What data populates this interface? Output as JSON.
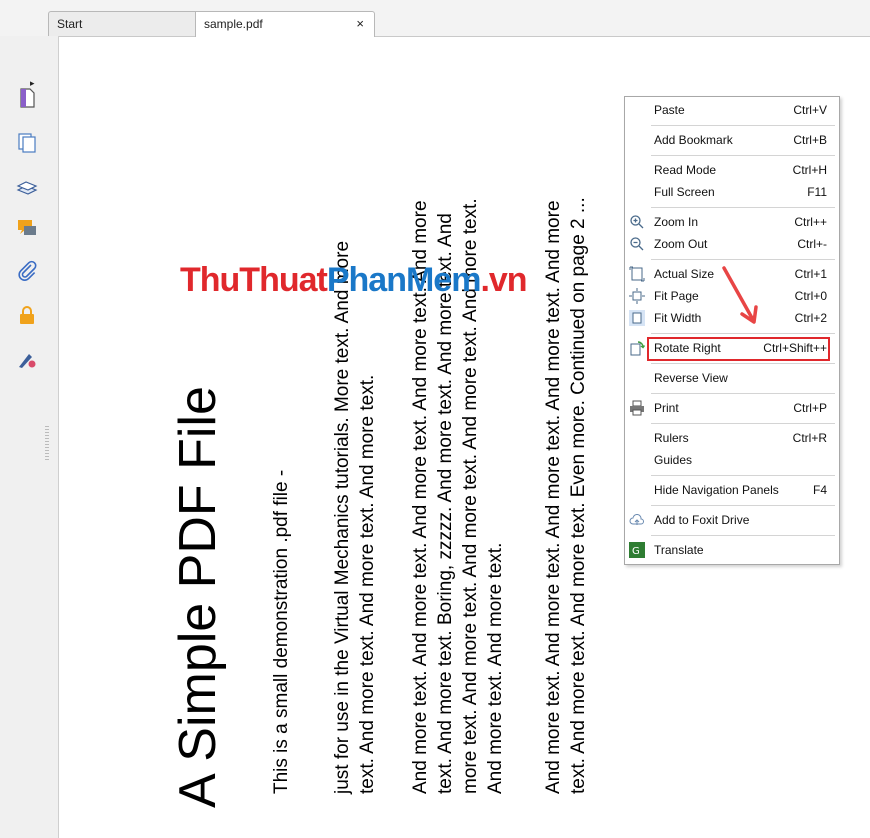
{
  "tabs": [
    {
      "label": "Start"
    },
    {
      "label": "sample.pdf",
      "close": "×"
    }
  ],
  "sidebar": {
    "collapse_glyph": "▸",
    "icons": [
      "pages-icon",
      "thumbnails-icon",
      "layers-icon",
      "comments-icon",
      "attachments-icon",
      "security-icon",
      "signature-icon"
    ]
  },
  "document": {
    "title": "A Simple PDF File",
    "line1": "This is a small demonstration .pdf file -",
    "para1": [
      "just for use in the Virtual Mechanics tutorials. More text. And more",
      "text. And more text. And more text. And more text."
    ],
    "para2": [
      "And more text. And more text. And more text. And more text. And more",
      "text. And more text. Boring, zzzzz. And more text. And more text. And",
      "more text. And more text. And more text. And more text. And more text.",
      "And more text. And more text."
    ],
    "para3": [
      "And more text. And more text. And more text. And more text. And more",
      "text. And more text. And more text. Even more. Continued on page 2 ..."
    ]
  },
  "watermark": {
    "part1": "ThuThuat",
    "part2": "PhanMem",
    "part3": ".vn"
  },
  "context_menu": {
    "items": {
      "paste": {
        "label": "Paste",
        "shortcut": "Ctrl+V"
      },
      "add_bookmark": {
        "label": "Add Bookmark",
        "shortcut": "Ctrl+B"
      },
      "read_mode": {
        "label": "Read Mode",
        "shortcut": "Ctrl+H"
      },
      "full_screen": {
        "label": "Full Screen",
        "shortcut": "F11"
      },
      "zoom_in": {
        "label": "Zoom In",
        "shortcut": "Ctrl++"
      },
      "zoom_out": {
        "label": "Zoom Out",
        "shortcut": "Ctrl+-"
      },
      "actual_size": {
        "label": "Actual Size",
        "shortcut": "Ctrl+1"
      },
      "fit_page": {
        "label": "Fit Page",
        "shortcut": "Ctrl+0"
      },
      "fit_width": {
        "label": "Fit Width",
        "shortcut": "Ctrl+2"
      },
      "rotate_right": {
        "label": "Rotate Right",
        "shortcut": "Ctrl+Shift++"
      },
      "reverse_view": {
        "label": "Reverse View",
        "shortcut": ""
      },
      "print": {
        "label": "Print",
        "shortcut": "Ctrl+P"
      },
      "rulers": {
        "label": "Rulers",
        "shortcut": "Ctrl+R"
      },
      "guides": {
        "label": "Guides",
        "shortcut": ""
      },
      "hide_nav": {
        "label": "Hide Navigation Panels",
        "shortcut": "F4"
      },
      "foxit_drive": {
        "label": "Add to Foxit Drive",
        "shortcut": ""
      },
      "translate": {
        "label": "Translate",
        "shortcut": ""
      }
    }
  },
  "colors": {
    "highlight": "#e0282c",
    "watermark_red": "#e0282c",
    "watermark_blue": "#1a78c8",
    "sidebar_icon": "#6a4aa0"
  }
}
